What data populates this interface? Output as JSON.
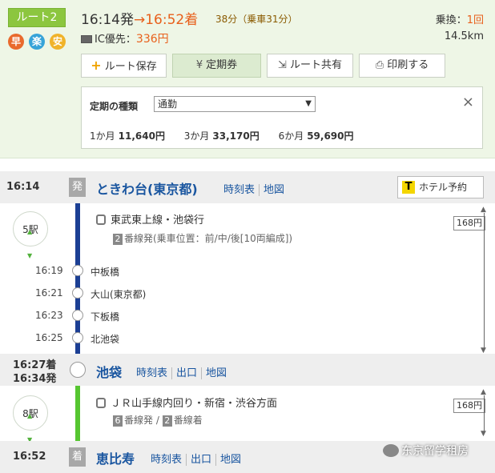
{
  "summary": {
    "route_label": "ルート2",
    "badges": [
      "早",
      "楽",
      "安"
    ],
    "depart": "16:14発",
    "arrow_arrive": "→16:52着",
    "duration": "38分（乗車31分）",
    "ic_label": "IC優先：",
    "ic_fare": "336円",
    "transfer_label": "乗換：",
    "transfer_count": "1回",
    "distance": "14.5km",
    "buttons": {
      "save": "ルート保存",
      "pass": "定期券",
      "share": "ルート共有",
      "print": "印刷する"
    }
  },
  "commuter_pass": {
    "label": "定期の種類",
    "selected": "通勤",
    "close": "×",
    "fares": [
      {
        "period": "1か月",
        "price": "11,640円"
      },
      {
        "period": "3か月",
        "price": "33,170円"
      },
      {
        "period": "6か月",
        "price": "59,690円"
      }
    ]
  },
  "route": {
    "origin": {
      "time": "16:14",
      "tag": "発",
      "name": "ときわ台(東京都)",
      "links": [
        "時刻表",
        "地図"
      ],
      "hotel": "ホテル予約"
    },
    "leg1": {
      "stations": "5駅",
      "train": "東武東上線・池袋行",
      "platform_num": "2",
      "platform_text": "番線発(乗車位置：前/中/後[10両編成])",
      "fare": "168円",
      "stops": [
        {
          "time": "16:19",
          "name": "中板橋"
        },
        {
          "time": "16:21",
          "name": "大山(東京都)"
        },
        {
          "time": "16:23",
          "name": "下板橋"
        },
        {
          "time": "16:25",
          "name": "北池袋"
        }
      ]
    },
    "transfer": {
      "arrive": "16:27着",
      "depart": "16:34発",
      "name": "池袋",
      "links": [
        "時刻表",
        "出口",
        "地図"
      ]
    },
    "leg2": {
      "stations": "8駅",
      "train": "ＪＲ山手線内回り・新宿・渋谷方面",
      "platform_from_num": "6",
      "platform_from": "番線発 / ",
      "platform_to_num": "2",
      "platform_to": "番線着",
      "fare": "168円"
    },
    "destination": {
      "time": "16:52",
      "tag": "着",
      "name": "恵比寿",
      "links": [
        "時刻表",
        "出口",
        "地図"
      ]
    }
  },
  "watermark": "东京留学租房"
}
